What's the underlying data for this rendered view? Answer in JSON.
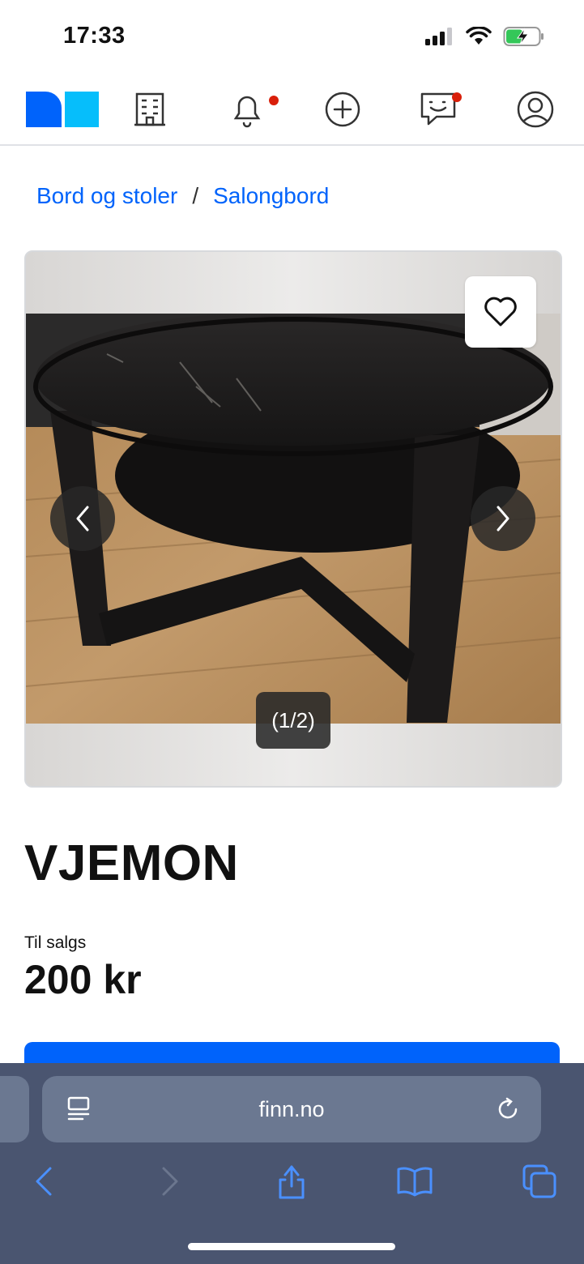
{
  "status": {
    "time": "17:33"
  },
  "header": {
    "icons": [
      "finn-logo",
      "building-icon",
      "bell-icon",
      "plus-circle-icon",
      "chat-icon",
      "profile-icon"
    ],
    "accent": "#0063fb",
    "notification_color": "#d91f0a"
  },
  "breadcrumb": {
    "items": [
      "Bord og stoler",
      "Salongbord"
    ],
    "separator": "/"
  },
  "gallery": {
    "counter": "(1/2)",
    "current": 1,
    "total": 2
  },
  "listing": {
    "title": "VJEMON",
    "status_label": "Til salgs",
    "price": "200 kr"
  },
  "browser": {
    "url": "finn.no"
  }
}
